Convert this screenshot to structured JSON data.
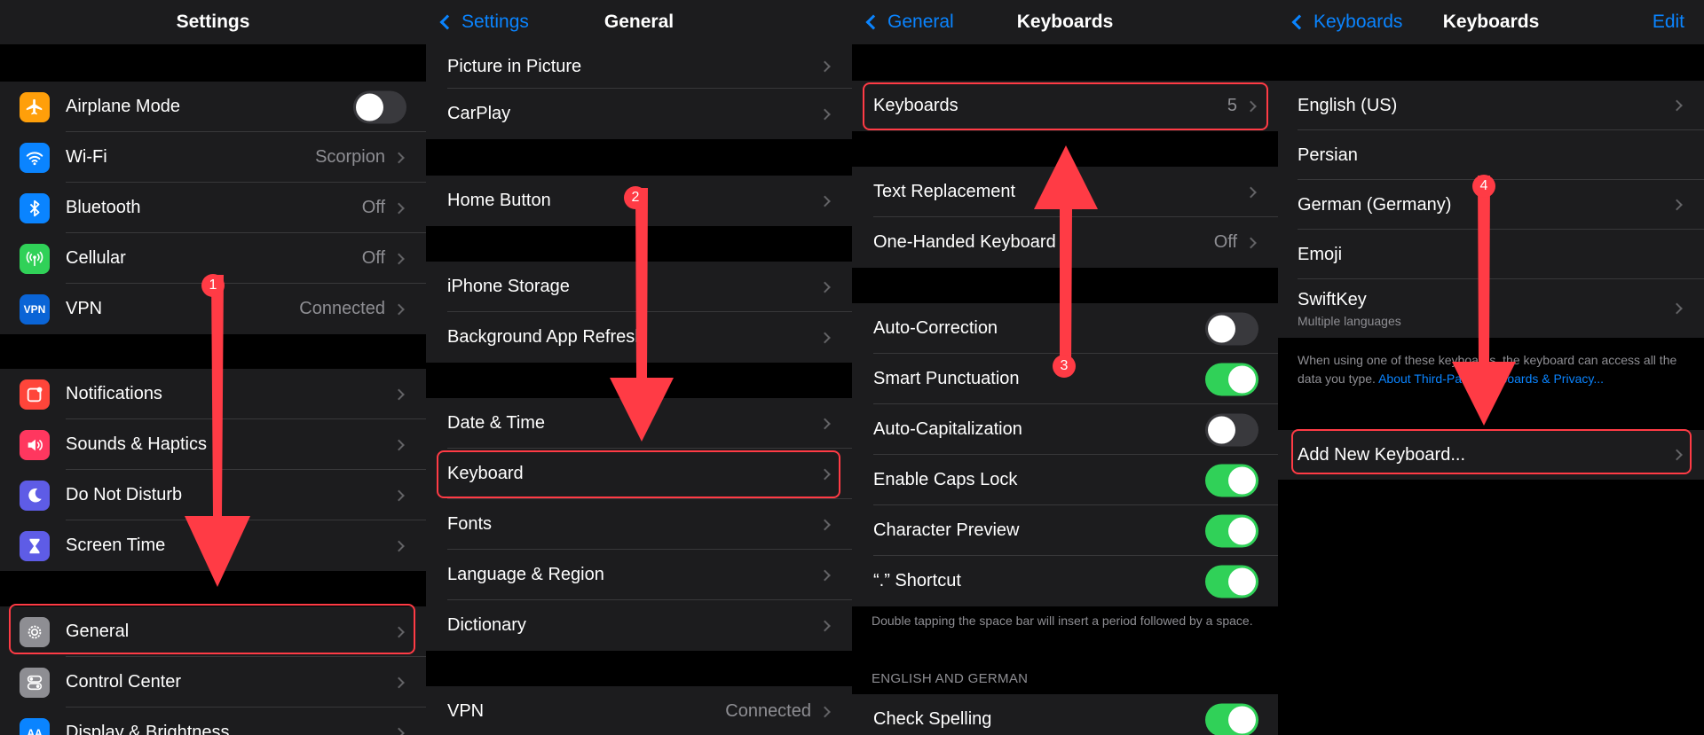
{
  "panel1": {
    "title": "Settings",
    "group1": [
      {
        "label": "Airplane Mode",
        "icon": "airplane-icon",
        "color": "#ff9f0a"
      },
      {
        "label": "Wi-Fi",
        "value": "Scorpion",
        "icon": "wifi-icon",
        "color": "#0a84ff"
      },
      {
        "label": "Bluetooth",
        "value": "Off",
        "icon": "bluetooth-icon",
        "color": "#0a84ff"
      },
      {
        "label": "Cellular",
        "value": "Off",
        "icon": "cellular-icon",
        "color": "#30d158"
      },
      {
        "label": "VPN",
        "value": "Connected",
        "icon_text": "VPN",
        "color": "#0a64d6"
      }
    ],
    "group2": [
      {
        "label": "Notifications",
        "icon": "notifications-icon",
        "color": "#ff453a"
      },
      {
        "label": "Sounds & Haptics",
        "icon": "sounds-icon",
        "color": "#ff375f"
      },
      {
        "label": "Do Not Disturb",
        "icon": "moon-icon",
        "color": "#5e5ce6"
      },
      {
        "label": "Screen Time",
        "icon": "hourglass-icon",
        "color": "#5e5ce6"
      }
    ],
    "group3": [
      {
        "label": "General",
        "icon": "gear-icon",
        "color": "#8e8e93"
      },
      {
        "label": "Control Center",
        "icon": "control-center-icon",
        "color": "#8e8e93"
      },
      {
        "label": "Display & Brightness",
        "icon_text": "AA",
        "color": "#0a84ff"
      }
    ]
  },
  "panel2": {
    "back": "Settings",
    "title": "General",
    "group1": [
      {
        "label": "Picture in Picture"
      },
      {
        "label": "CarPlay"
      }
    ],
    "group2": [
      {
        "label": "Home Button"
      }
    ],
    "group3": [
      {
        "label": "iPhone Storage"
      },
      {
        "label": "Background App Refresh"
      }
    ],
    "group4": [
      {
        "label": "Date & Time"
      },
      {
        "label": "Keyboard"
      },
      {
        "label": "Fonts"
      },
      {
        "label": "Language & Region"
      },
      {
        "label": "Dictionary"
      }
    ],
    "group5": [
      {
        "label": "VPN",
        "value": "Connected"
      }
    ]
  },
  "panel3": {
    "back": "General",
    "title": "Keyboards",
    "group1": [
      {
        "label": "Keyboards",
        "value": "5"
      }
    ],
    "group2": [
      {
        "label": "Text Replacement"
      },
      {
        "label": "One-Handed Keyboard",
        "value": "Off"
      }
    ],
    "group3": [
      {
        "label": "Auto-Correction",
        "on": false
      },
      {
        "label": "Smart Punctuation",
        "on": true
      },
      {
        "label": "Auto-Capitalization",
        "on": false
      },
      {
        "label": "Enable Caps Lock",
        "on": true
      },
      {
        "label": "Character Preview",
        "on": true
      },
      {
        "label": "“.” Shortcut",
        "on": true
      }
    ],
    "footnote": "Double tapping the space bar will insert a period followed by a space.",
    "section_header": "ENGLISH AND GERMAN",
    "group4": [
      {
        "label": "Check Spelling",
        "on": true
      }
    ]
  },
  "panel4": {
    "back": "Keyboards",
    "title": "Keyboards",
    "edit": "Edit",
    "group1": [
      {
        "label": "English (US)",
        "chevron": true
      },
      {
        "label": "Persian",
        "chevron": false
      },
      {
        "label": "German (Germany)",
        "chevron": true
      },
      {
        "label": "Emoji",
        "chevron": false
      },
      {
        "label": "SwiftKey",
        "sublabel": "Multiple languages",
        "chevron": true
      }
    ],
    "footnote_text": "When using one of these keyboards, the keyboard can access all the data you type.",
    "footnote_link": "About Third-Party Keyboards & Privacy...",
    "group2": [
      {
        "label": "Add New Keyboard..."
      }
    ]
  },
  "steps": [
    "1",
    "2",
    "3",
    "4"
  ],
  "colors": {
    "background": "#000000",
    "cell": "#1c1c1e",
    "separator": "#38383a",
    "secondary_text": "#8e8e93",
    "accent": "#0a84ff",
    "toggle_on": "#30d158",
    "annotation": "#ff3b45"
  }
}
